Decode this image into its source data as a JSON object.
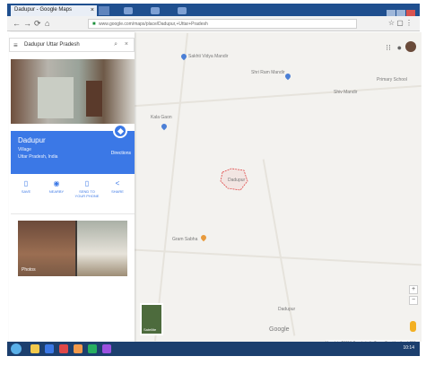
{
  "browser": {
    "tab_title": "Dadupur - Google Maps",
    "tab_close": "×",
    "url": "www.google.com/maps/place/Dadupur,+Uttar+Pradesh",
    "nav": {
      "back": "←",
      "forward": "→",
      "reload": "⟳",
      "home": "⌂"
    }
  },
  "panel": {
    "search_value": "Dadupur Uttar Pradesh",
    "place_name": "Dadupur",
    "place_type": "Village",
    "place_region": "Uttar Pradesh, India",
    "directions_label": "Directions",
    "actions": [
      {
        "icon": "save-icon",
        "glyph": "▯",
        "label": "SAVE"
      },
      {
        "icon": "nearby-icon",
        "glyph": "◉",
        "label": "NEARBY"
      },
      {
        "icon": "phone-icon",
        "glyph": "▯",
        "label": "SEND TO YOUR PHONE"
      },
      {
        "icon": "share-icon",
        "glyph": "<",
        "label": "SHARE"
      }
    ],
    "photos_label": "Photos"
  },
  "map": {
    "labels": [
      {
        "key": "school",
        "text": "Sakhti Vidya Mandir"
      },
      {
        "key": "temple",
        "text": "Shri Ram Mandir"
      },
      {
        "key": "left",
        "text": "Kala Gaon"
      },
      {
        "key": "right1",
        "text": "Shiv Mandir"
      },
      {
        "key": "right2",
        "text": "Primary School"
      },
      {
        "key": "center",
        "text": "Dadupur"
      },
      {
        "key": "orange",
        "text": "Gram Sabha"
      },
      {
        "key": "bottom",
        "text": "Dadupur"
      }
    ],
    "satellite_label": "Satellite",
    "google": "Google",
    "footer": "Map data ©2019 Google   India   Terms   Send feedback   200 m"
  },
  "taskbar": {
    "clock": "10:14"
  },
  "colors": {
    "accent": "#3b78e6",
    "boundary": "#e04848",
    "map_bg": "#f3f2ef"
  }
}
